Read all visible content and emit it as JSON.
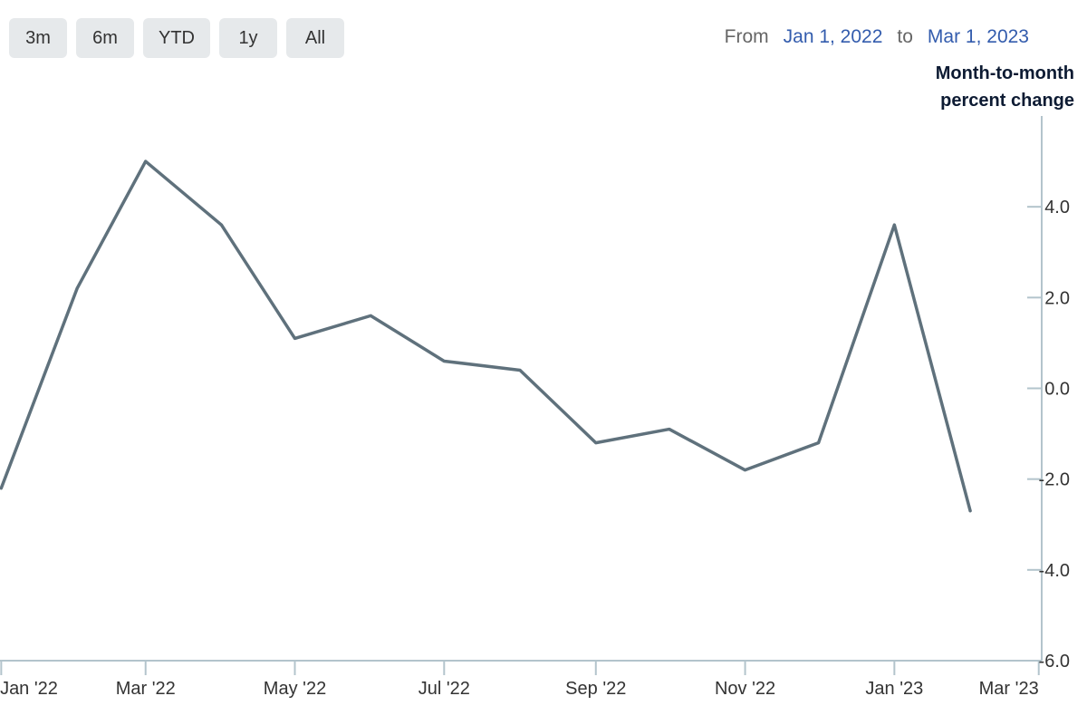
{
  "range_selector": {
    "buttons": [
      "3m",
      "6m",
      "YTD",
      "1y",
      "All"
    ]
  },
  "date_range": {
    "from_label": "From",
    "from_value": "Jan 1, 2022",
    "to_label": "to",
    "to_value": "Mar 1, 2023"
  },
  "chart_data": {
    "type": "line",
    "title": "",
    "ylabel": "Month-to-month\npercent change",
    "xlabel": "",
    "x_tick_labels": [
      "Jan '22",
      "Mar '22",
      "May '22",
      "Jul '22",
      "Sep '22",
      "Nov '22",
      "Jan '23",
      "Mar '23"
    ],
    "y_tick_labels": [
      "4.0",
      "2.0",
      "0.0",
      "-2.0",
      "-4.0",
      "-6.0"
    ],
    "xlim": [
      "2022-01-01",
      "2023-03-01"
    ],
    "ylim": [
      -6,
      6
    ],
    "grid": false,
    "legend": false,
    "series": [
      {
        "color": "#5f717c",
        "points": [
          {
            "x": "2022-01",
            "y": -2.2
          },
          {
            "x": "2022-02",
            "y": 2.2
          },
          {
            "x": "2022-03",
            "y": 5.0
          },
          {
            "x": "2022-04",
            "y": 3.6
          },
          {
            "x": "2022-05",
            "y": 1.1
          },
          {
            "x": "2022-06",
            "y": 1.6
          },
          {
            "x": "2022-07",
            "y": 0.6
          },
          {
            "x": "2022-08",
            "y": 0.4
          },
          {
            "x": "2022-09",
            "y": -1.2
          },
          {
            "x": "2022-10",
            "y": -0.9
          },
          {
            "x": "2022-11",
            "y": -1.8
          },
          {
            "x": "2022-12",
            "y": -1.2
          },
          {
            "x": "2023-01",
            "y": 3.6
          },
          {
            "x": "2023-02",
            "y": -2.7
          }
        ]
      }
    ]
  },
  "colors": {
    "axis": "#b3c4cc",
    "line": "#5f717c",
    "date_value": "#335cad",
    "button_bg": "#e6e9eb"
  }
}
